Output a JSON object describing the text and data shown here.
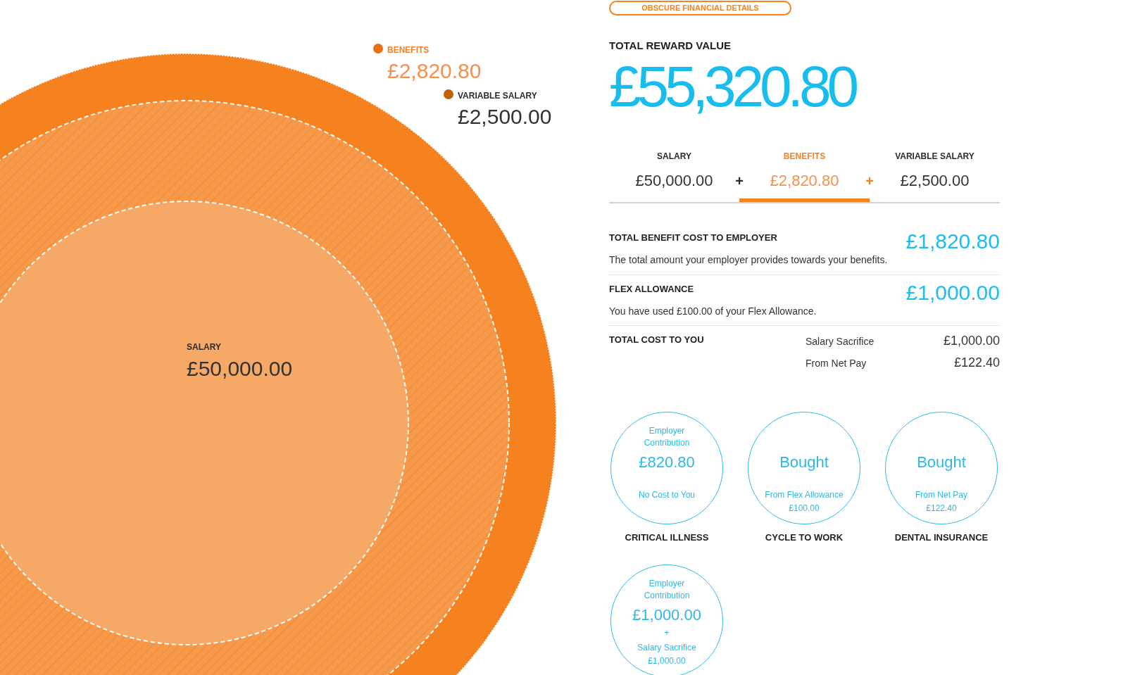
{
  "chart": {
    "legend": [
      {
        "label": "BENEFITS",
        "amount": "£2,820.80",
        "color": "#e8700f",
        "selected": true
      },
      {
        "label": "VARIABLE SALARY",
        "amount": "£2,500.00",
        "color": "#c0600c",
        "selected": false
      }
    ],
    "salary_label": {
      "label": "SALARY",
      "amount": "£50,000.00"
    }
  },
  "obscure_button": {
    "label": "OBSCURE FINANCIAL DETAILS"
  },
  "total_reward": {
    "label": "TOTAL REWARD VALUE",
    "amount": "£55,320.80"
  },
  "tabs": [
    {
      "label": "SALARY",
      "amount": "£50,000.00",
      "operator": "+",
      "selected": false
    },
    {
      "label": "BENEFITS",
      "amount": "£2,820.80",
      "operator": "+",
      "selected": true
    },
    {
      "label": "VARIABLE SALARY",
      "amount": "£2,500.00",
      "selected": false
    }
  ],
  "summary": [
    {
      "title": "TOTAL BENEFIT COST TO EMPLOYER",
      "amount": "£1,820.80",
      "description": "The total amount your employer provides towards your benefits."
    },
    {
      "title": "FLEX ALLOWANCE",
      "amount": "£1,000.00",
      "description": "You have used £100.00 of your Flex Allowance."
    }
  ],
  "cost_to_you": {
    "title": "TOTAL COST TO YOU",
    "lines": [
      {
        "label": "Salary Sacrifice",
        "amount": "£1,000.00"
      },
      {
        "label": "From Net Pay",
        "amount": "£122.40"
      }
    ]
  },
  "benefits": [
    {
      "name": "CRITICAL ILLNESS",
      "caption": "Employer Contribution",
      "main": "£820.80",
      "details": [
        "No Cost to You"
      ]
    },
    {
      "name": "CYCLE TO WORK",
      "main": "Bought",
      "details": [
        "From Flex Allowance",
        "£100.00"
      ]
    },
    {
      "name": "DENTAL INSURANCE",
      "main": "Bought",
      "details": [
        "From Net Pay",
        "£122.40"
      ]
    },
    {
      "caption": "Employer Contribution",
      "main": "£1,000.00",
      "connector": "+",
      "details": [
        "Salary Sacrifice",
        "£1,000.00"
      ]
    }
  ]
}
